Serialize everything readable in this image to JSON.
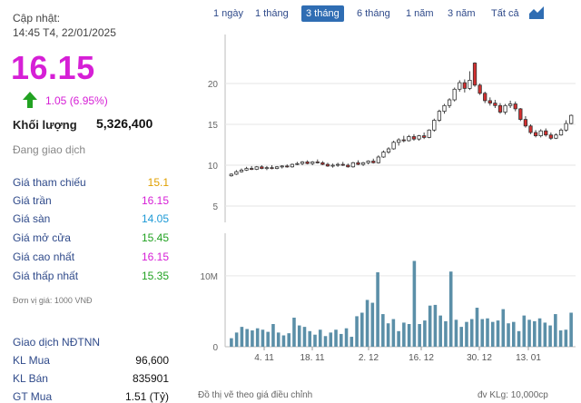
{
  "quote": {
    "updated_label": "Cập nhật:",
    "updated_time": "14:45 T4, 22/01/2025",
    "price": "16.15",
    "change": "1.05 (6.95%)",
    "volume_label": "Khối lượng",
    "volume_value": "5,326,400",
    "status": "Đang giao dịch",
    "unit_note": "Đơn vị giá: 1000 VNĐ",
    "colors": {
      "ceiling": "#d61fd6",
      "reference": "#e0a000",
      "floor": "#1e9ad6",
      "up": "#22a222",
      "down": "#d32f2f"
    }
  },
  "price_rows": [
    {
      "label": "Giá tham chiếu",
      "value": "15.1",
      "color": "#e0a000"
    },
    {
      "label": "Giá trần",
      "value": "16.15",
      "color": "#d61fd6"
    },
    {
      "label": "Giá sàn",
      "value": "14.05",
      "color": "#1e9ad6"
    },
    {
      "label": "Giá mở cửa",
      "value": "15.45",
      "color": "#22a222"
    },
    {
      "label": "Giá cao nhất",
      "value": "16.15",
      "color": "#d61fd6"
    },
    {
      "label": "Giá thấp nhất",
      "value": "15.35",
      "color": "#22a222"
    }
  ],
  "foreign": {
    "title": "Giao dịch NĐTNN",
    "rows": [
      {
        "label": "KL Mua",
        "value": "96,600"
      },
      {
        "label": "KL Bán",
        "value": "835901"
      },
      {
        "label": "GT Mua",
        "value": "1.51 (Tỷ)"
      }
    ]
  },
  "range_tabs": [
    {
      "label": "1 ngày",
      "active": false
    },
    {
      "label": "1 tháng",
      "active": false
    },
    {
      "label": "3 tháng",
      "active": true
    },
    {
      "label": "6 tháng",
      "active": false
    },
    {
      "label": "1 năm",
      "active": false
    },
    {
      "label": "3 năm",
      "active": false
    },
    {
      "label": "Tất cả",
      "active": false
    }
  ],
  "chart_type_icon": "area-chart-icon",
  "footnote": "Đồ thị vẽ theo giá điều chỉnh",
  "volume_unit": "đv KLg: 10,000cp",
  "chart_data": {
    "type": "candlestick",
    "price_axis": {
      "ticks": [
        "20",
        "15",
        "10",
        "5"
      ],
      "ylim": [
        3,
        26
      ]
    },
    "volume_axis": {
      "ticks": [
        "10M",
        "0"
      ],
      "ylim": [
        0,
        16
      ]
    },
    "x_ticks": [
      "4. 11",
      "18. 11",
      "2. 12",
      "16. 12",
      "30. 12",
      "13. 01"
    ],
    "candles": [
      {
        "o": 8.7,
        "h": 9.0,
        "l": 8.6,
        "c": 8.9
      },
      {
        "o": 8.9,
        "h": 9.4,
        "l": 8.8,
        "c": 9.2
      },
      {
        "o": 9.2,
        "h": 9.6,
        "l": 9.1,
        "c": 9.4
      },
      {
        "o": 9.4,
        "h": 9.8,
        "l": 9.3,
        "c": 9.6
      },
      {
        "o": 9.6,
        "h": 9.9,
        "l": 9.4,
        "c": 9.5
      },
      {
        "o": 9.5,
        "h": 9.9,
        "l": 9.4,
        "c": 9.8
      },
      {
        "o": 9.8,
        "h": 10.0,
        "l": 9.5,
        "c": 9.6
      },
      {
        "o": 9.6,
        "h": 9.9,
        "l": 9.4,
        "c": 9.7
      },
      {
        "o": 9.7,
        "h": 10.0,
        "l": 9.5,
        "c": 9.6
      },
      {
        "o": 9.6,
        "h": 9.9,
        "l": 9.5,
        "c": 9.8
      },
      {
        "o": 9.8,
        "h": 10.0,
        "l": 9.6,
        "c": 9.9
      },
      {
        "o": 9.9,
        "h": 10.1,
        "l": 9.7,
        "c": 9.8
      },
      {
        "o": 9.8,
        "h": 10.2,
        "l": 9.7,
        "c": 10.1
      },
      {
        "o": 10.1,
        "h": 10.4,
        "l": 10.0,
        "c": 10.2
      },
      {
        "o": 10.2,
        "h": 10.5,
        "l": 10.0,
        "c": 10.4
      },
      {
        "o": 10.4,
        "h": 10.6,
        "l": 10.1,
        "c": 10.2
      },
      {
        "o": 10.2,
        "h": 10.5,
        "l": 10.0,
        "c": 10.4
      },
      {
        "o": 10.4,
        "h": 10.7,
        "l": 10.2,
        "c": 10.3
      },
      {
        "o": 10.3,
        "h": 10.5,
        "l": 10.0,
        "c": 10.1
      },
      {
        "o": 10.1,
        "h": 10.3,
        "l": 9.8,
        "c": 9.9
      },
      {
        "o": 9.9,
        "h": 10.2,
        "l": 9.7,
        "c": 10.0
      },
      {
        "o": 10.0,
        "h": 10.3,
        "l": 9.8,
        "c": 10.1
      },
      {
        "o": 10.1,
        "h": 10.4,
        "l": 9.9,
        "c": 10.0
      },
      {
        "o": 10.0,
        "h": 10.2,
        "l": 9.7,
        "c": 9.8
      },
      {
        "o": 9.8,
        "h": 10.4,
        "l": 9.7,
        "c": 10.3
      },
      {
        "o": 10.3,
        "h": 10.6,
        "l": 10.0,
        "c": 10.1
      },
      {
        "o": 10.1,
        "h": 10.4,
        "l": 9.9,
        "c": 10.3
      },
      {
        "o": 10.3,
        "h": 10.6,
        "l": 10.1,
        "c": 10.5
      },
      {
        "o": 10.5,
        "h": 10.8,
        "l": 10.2,
        "c": 10.3
      },
      {
        "o": 10.3,
        "h": 11.2,
        "l": 10.2,
        "c": 11.0
      },
      {
        "o": 11.0,
        "h": 11.8,
        "l": 10.9,
        "c": 11.6
      },
      {
        "o": 11.6,
        "h": 12.2,
        "l": 11.4,
        "c": 12.0
      },
      {
        "o": 12.0,
        "h": 13.0,
        "l": 11.9,
        "c": 12.8
      },
      {
        "o": 12.8,
        "h": 13.3,
        "l": 12.4,
        "c": 13.1
      },
      {
        "o": 13.1,
        "h": 13.6,
        "l": 12.8,
        "c": 13.0
      },
      {
        "o": 13.0,
        "h": 13.7,
        "l": 12.9,
        "c": 13.5
      },
      {
        "o": 13.5,
        "h": 13.8,
        "l": 13.0,
        "c": 13.2
      },
      {
        "o": 13.2,
        "h": 13.7,
        "l": 13.0,
        "c": 13.6
      },
      {
        "o": 13.6,
        "h": 14.0,
        "l": 13.2,
        "c": 13.4
      },
      {
        "o": 13.4,
        "h": 14.4,
        "l": 13.3,
        "c": 14.3
      },
      {
        "o": 14.3,
        "h": 15.7,
        "l": 14.1,
        "c": 15.5
      },
      {
        "o": 15.5,
        "h": 16.8,
        "l": 15.3,
        "c": 16.6
      },
      {
        "o": 16.6,
        "h": 17.5,
        "l": 16.3,
        "c": 17.3
      },
      {
        "o": 17.3,
        "h": 18.2,
        "l": 17.0,
        "c": 18.0
      },
      {
        "o": 18.0,
        "h": 19.5,
        "l": 17.8,
        "c": 19.3
      },
      {
        "o": 19.3,
        "h": 20.4,
        "l": 19.0,
        "c": 20.1
      },
      {
        "o": 20.1,
        "h": 20.5,
        "l": 18.9,
        "c": 19.4
      },
      {
        "o": 19.4,
        "h": 21.5,
        "l": 19.2,
        "c": 20.4
      },
      {
        "o": 22.5,
        "h": 22.6,
        "l": 19.6,
        "c": 19.8
      },
      {
        "o": 19.8,
        "h": 20.0,
        "l": 18.6,
        "c": 18.8
      },
      {
        "o": 18.8,
        "h": 19.0,
        "l": 17.6,
        "c": 17.9
      },
      {
        "o": 17.9,
        "h": 18.3,
        "l": 17.3,
        "c": 17.6
      },
      {
        "o": 17.6,
        "h": 18.0,
        "l": 17.0,
        "c": 17.3
      },
      {
        "o": 17.3,
        "h": 17.6,
        "l": 16.3,
        "c": 16.5
      },
      {
        "o": 16.5,
        "h": 17.5,
        "l": 16.2,
        "c": 17.3
      },
      {
        "o": 17.3,
        "h": 17.9,
        "l": 17.0,
        "c": 17.5
      },
      {
        "o": 17.5,
        "h": 17.8,
        "l": 16.6,
        "c": 16.9
      },
      {
        "o": 16.9,
        "h": 17.0,
        "l": 15.4,
        "c": 15.6
      },
      {
        "o": 15.6,
        "h": 16.0,
        "l": 14.6,
        "c": 14.8
      },
      {
        "o": 14.8,
        "h": 15.0,
        "l": 13.8,
        "c": 14.0
      },
      {
        "o": 14.0,
        "h": 14.3,
        "l": 13.4,
        "c": 13.6
      },
      {
        "o": 13.6,
        "h": 14.4,
        "l": 13.4,
        "c": 14.2
      },
      {
        "o": 14.2,
        "h": 14.5,
        "l": 13.5,
        "c": 13.7
      },
      {
        "o": 13.7,
        "h": 14.0,
        "l": 13.1,
        "c": 13.3
      },
      {
        "o": 13.3,
        "h": 13.9,
        "l": 13.2,
        "c": 13.7
      },
      {
        "o": 13.7,
        "h": 14.5,
        "l": 13.6,
        "c": 14.3
      },
      {
        "o": 14.3,
        "h": 15.5,
        "l": 14.1,
        "c": 15.1
      },
      {
        "o": 15.1,
        "h": 16.2,
        "l": 15.0,
        "c": 16.1
      }
    ],
    "volumes": [
      1.2,
      2.0,
      2.8,
      2.5,
      2.3,
      2.6,
      2.4,
      2.1,
      3.2,
      2.0,
      1.6,
      1.9,
      4.1,
      3.0,
      2.8,
      2.2,
      1.7,
      2.4,
      1.5,
      2.0,
      2.4,
      1.8,
      2.6,
      1.4,
      4.3,
      4.8,
      6.6,
      6.2,
      10.5,
      4.6,
      3.3,
      3.9,
      2.2,
      3.4,
      3.2,
      12.1,
      3.2,
      3.7,
      5.8,
      5.9,
      4.4,
      3.6,
      10.6,
      3.8,
      2.8,
      3.5,
      3.9,
      5.5,
      3.9,
      4.0,
      3.5,
      3.7,
      5.3,
      3.3,
      3.5,
      2.2,
      4.4,
      3.8,
      3.6,
      4.0,
      3.4,
      3.0,
      4.6,
      2.3,
      2.4,
      4.8
    ]
  }
}
